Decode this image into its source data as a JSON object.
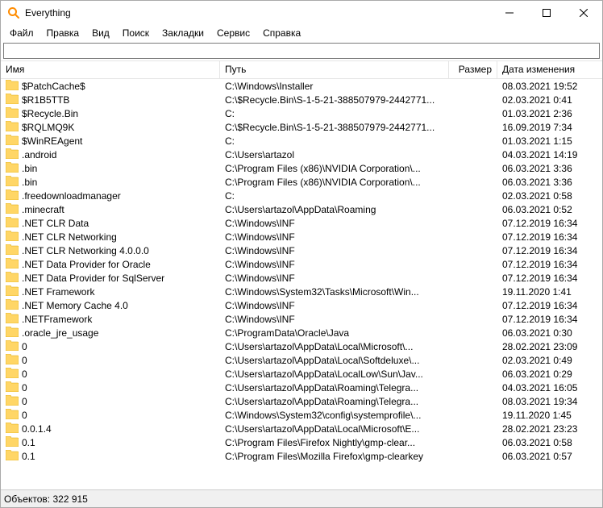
{
  "window": {
    "title": "Everything"
  },
  "menu": {
    "file": "Файл",
    "edit": "Правка",
    "view": "Вид",
    "search": "Поиск",
    "bookmarks": "Закладки",
    "tools": "Сервис",
    "help": "Справка"
  },
  "search": {
    "value": ""
  },
  "columns": {
    "name": "Имя",
    "path": "Путь",
    "size": "Размер",
    "date": "Дата изменения"
  },
  "rows": [
    {
      "name": "$PatchCache$",
      "path": "C:\\Windows\\Installer",
      "size": "",
      "date": "08.03.2021 19:52"
    },
    {
      "name": "$R1B5TTB",
      "path": "C:\\$Recycle.Bin\\S-1-5-21-388507979-2442771...",
      "size": "",
      "date": "02.03.2021 0:41"
    },
    {
      "name": "$Recycle.Bin",
      "path": "C:",
      "size": "",
      "date": "01.03.2021 2:36"
    },
    {
      "name": "$RQLMQ9K",
      "path": "C:\\$Recycle.Bin\\S-1-5-21-388507979-2442771...",
      "size": "",
      "date": "16.09.2019 7:34"
    },
    {
      "name": "$WinREAgent",
      "path": "C:",
      "size": "",
      "date": "01.03.2021 1:15"
    },
    {
      "name": ".android",
      "path": "C:\\Users\\artazol",
      "size": "",
      "date": "04.03.2021 14:19"
    },
    {
      "name": ".bin",
      "path": "C:\\Program Files (x86)\\NVIDIA Corporation\\...",
      "size": "",
      "date": "06.03.2021 3:36"
    },
    {
      "name": ".bin",
      "path": "C:\\Program Files (x86)\\NVIDIA Corporation\\...",
      "size": "",
      "date": "06.03.2021 3:36"
    },
    {
      "name": ".freedownloadmanager",
      "path": "C:",
      "size": "",
      "date": "02.03.2021 0:58"
    },
    {
      "name": ".minecraft",
      "path": "C:\\Users\\artazol\\AppData\\Roaming",
      "size": "",
      "date": "06.03.2021 0:52"
    },
    {
      "name": ".NET CLR Data",
      "path": "C:\\Windows\\INF",
      "size": "",
      "date": "07.12.2019 16:34"
    },
    {
      "name": ".NET CLR Networking",
      "path": "C:\\Windows\\INF",
      "size": "",
      "date": "07.12.2019 16:34"
    },
    {
      "name": ".NET CLR Networking 4.0.0.0",
      "path": "C:\\Windows\\INF",
      "size": "",
      "date": "07.12.2019 16:34"
    },
    {
      "name": ".NET Data Provider for Oracle",
      "path": "C:\\Windows\\INF",
      "size": "",
      "date": "07.12.2019 16:34"
    },
    {
      "name": ".NET Data Provider for SqlServer",
      "path": "C:\\Windows\\INF",
      "size": "",
      "date": "07.12.2019 16:34"
    },
    {
      "name": ".NET Framework",
      "path": "C:\\Windows\\System32\\Tasks\\Microsoft\\Win...",
      "size": "",
      "date": "19.11.2020 1:41"
    },
    {
      "name": ".NET Memory Cache 4.0",
      "path": "C:\\Windows\\INF",
      "size": "",
      "date": "07.12.2019 16:34"
    },
    {
      "name": ".NETFramework",
      "path": "C:\\Windows\\INF",
      "size": "",
      "date": "07.12.2019 16:34"
    },
    {
      "name": ".oracle_jre_usage",
      "path": "C:\\ProgramData\\Oracle\\Java",
      "size": "",
      "date": "06.03.2021 0:30"
    },
    {
      "name": "0",
      "path": "C:\\Users\\artazol\\AppData\\Local\\Microsoft\\...",
      "size": "",
      "date": "28.02.2021 23:09"
    },
    {
      "name": "0",
      "path": "C:\\Users\\artazol\\AppData\\Local\\Softdeluxe\\...",
      "size": "",
      "date": "02.03.2021 0:49"
    },
    {
      "name": "0",
      "path": "C:\\Users\\artazol\\AppData\\LocalLow\\Sun\\Jav...",
      "size": "",
      "date": "06.03.2021 0:29"
    },
    {
      "name": "0",
      "path": "C:\\Users\\artazol\\AppData\\Roaming\\Telegra...",
      "size": "",
      "date": "04.03.2021 16:05"
    },
    {
      "name": "0",
      "path": "C:\\Users\\artazol\\AppData\\Roaming\\Telegra...",
      "size": "",
      "date": "08.03.2021 19:34"
    },
    {
      "name": "0",
      "path": "C:\\Windows\\System32\\config\\systemprofile\\...",
      "size": "",
      "date": "19.11.2020 1:45"
    },
    {
      "name": "0.0.1.4",
      "path": "C:\\Users\\artazol\\AppData\\Local\\Microsoft\\E...",
      "size": "",
      "date": "28.02.2021 23:23"
    },
    {
      "name": "0.1",
      "path": "C:\\Program Files\\Firefox Nightly\\gmp-clear...",
      "size": "",
      "date": "06.03.2021 0:58"
    },
    {
      "name": "0.1",
      "path": "C:\\Program Files\\Mozilla Firefox\\gmp-clearkey",
      "size": "",
      "date": "06.03.2021 0:57"
    }
  ],
  "status": {
    "label": "Объектов:",
    "count": "322 915"
  }
}
